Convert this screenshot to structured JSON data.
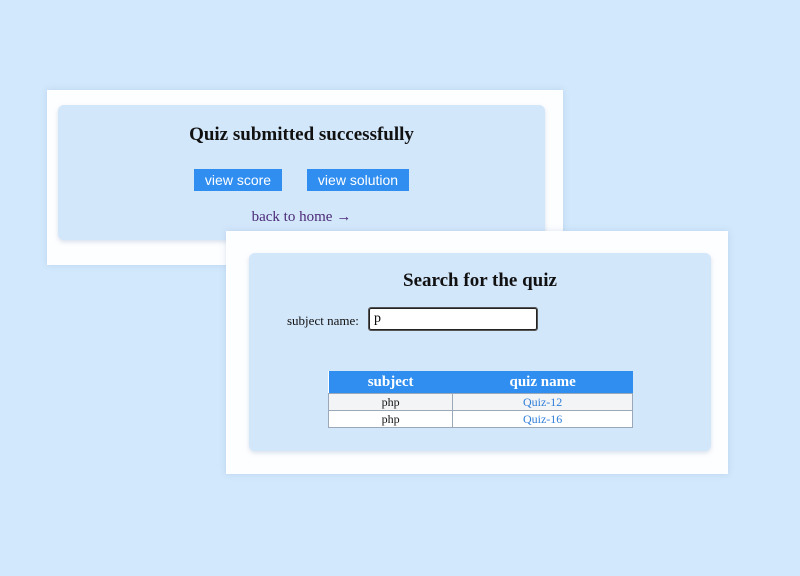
{
  "submitted_card": {
    "title": "Quiz submitted successfully",
    "view_score_label": "view score",
    "view_solution_label": "view solution",
    "back_link_text": "back to home",
    "back_link_arrow": "→"
  },
  "search_card": {
    "title": "Search for the quiz",
    "subject_label": "subject name:",
    "search_value": "p",
    "table": {
      "headers": [
        "subject",
        "quiz name"
      ],
      "rows": [
        {
          "subject": "php",
          "quiz_name": "Quiz-12"
        },
        {
          "subject": "php",
          "quiz_name": "Quiz-16"
        }
      ]
    }
  },
  "colors": {
    "background": "#d2e8fc",
    "panel": "#d3e7fb",
    "accent": "#2f8ef0",
    "link": "#4b2a78"
  }
}
